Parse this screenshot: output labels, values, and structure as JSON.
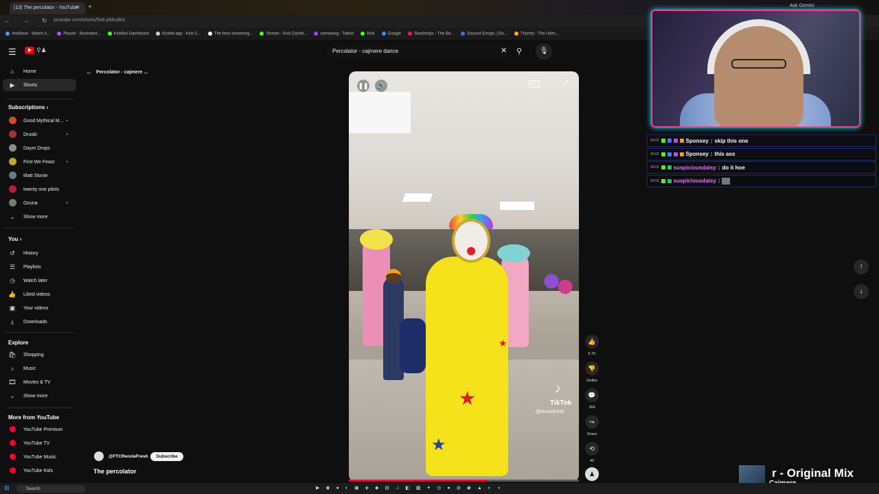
{
  "browser": {
    "tab_title": "(13) The percolator - YouTube",
    "new_tab": "+",
    "close": "✕",
    "ask_gemini": "Ask Gemini",
    "url": "youtube.com/shorts/5x6-p58udKs",
    "nav_icons": "← → ↻",
    "bookmarks": [
      {
        "label": "AniWave - Watch A...",
        "color": "#6b8cff"
      },
      {
        "label": "Placeit - Illustrated...",
        "color": "#9b5cff"
      },
      {
        "label": "KickBot Dashboard",
        "color": "#53fc18"
      },
      {
        "label": "Kicklet.app - Kick C...",
        "color": "#cccccc"
      },
      {
        "label": "The best streaming...",
        "color": "#ffffff"
      },
      {
        "label": "Stream - Kick Dashb...",
        "color": "#53fc18"
      },
      {
        "label": "samwiseg - Twitch",
        "color": "#9146ff"
      },
      {
        "label": "Kick",
        "color": "#53fc18"
      },
      {
        "label": "Google",
        "color": "#4285f4"
      },
      {
        "label": "Slackmojis - The Be...",
        "color": "#e01e5a"
      },
      {
        "label": "Discord Emojis | Dis...",
        "color": "#5865f2"
      },
      {
        "label": "Thomfy - The Ultim...",
        "color": "#f2b01e"
      }
    ]
  },
  "header": {
    "search_value": "Percolator - cajmere dance",
    "clear": "✕",
    "search_icon": "🔍",
    "mic_icon": "🎙"
  },
  "sidebar": {
    "main": [
      {
        "label": "Home",
        "icon": "⌂"
      },
      {
        "label": "Shorts",
        "icon": "▶"
      }
    ],
    "subscriptions_title": "Subscriptions ›",
    "subscriptions": [
      {
        "label": "Good Mythical M...",
        "color": "#d9472b",
        "live": "•"
      },
      {
        "label": "Druski",
        "color": "#a83232",
        "live": "•"
      },
      {
        "label": "Daym Drops",
        "color": "#8a8a8a",
        "live": ""
      },
      {
        "label": "First We Feast",
        "color": "#c7a32c",
        "live": "•"
      },
      {
        "label": "Matt Stonie",
        "color": "#6a7a8a",
        "live": ""
      },
      {
        "label": "twenty one pilots",
        "color": "#b5202a",
        "live": ""
      },
      {
        "label": "Ozuna",
        "color": "#7a7a7a",
        "live": "•"
      }
    ],
    "show_more": "Show more",
    "you_title": "You ›",
    "you": [
      {
        "label": "History",
        "icon": "↺"
      },
      {
        "label": "Playlists",
        "icon": "☰"
      },
      {
        "label": "Watch later",
        "icon": "◷"
      },
      {
        "label": "Liked videos",
        "icon": "👍"
      },
      {
        "label": "Your videos",
        "icon": "▣"
      },
      {
        "label": "Downloads",
        "icon": "⤓"
      }
    ],
    "explore_title": "Explore",
    "explore": [
      {
        "label": "Shopping",
        "icon": "🛍"
      },
      {
        "label": "Music",
        "icon": "♪"
      },
      {
        "label": "Movies & TV",
        "icon": "🎞"
      }
    ],
    "show_more_2": "Show more",
    "more_title": "More from YouTube",
    "more": [
      {
        "label": "YouTube Premium",
        "color": "#ff0033"
      },
      {
        "label": "YouTube TV",
        "color": "#ff0033"
      },
      {
        "label": "YouTube Music",
        "color": "#ff0033"
      },
      {
        "label": "YouTube Kids",
        "color": "#ff0033"
      }
    ]
  },
  "short": {
    "back_title": "Percolator - cajmere ...",
    "channel": "@FTCRenzieFresh",
    "subscribe": "Subscribe",
    "title": "The percolator",
    "tiktok": "TikTok",
    "tiktok_user": "@renziefresh",
    "cc": "CC",
    "progress": 0.6
  },
  "actions": {
    "like_count": "6.7K",
    "dislike": "Dislike",
    "comments": "364",
    "share": "Share",
    "remix": "40"
  },
  "chat": [
    {
      "time": "00:03",
      "user": "Sponsey",
      "user_color": "#ffffff",
      "msg": "skip this one",
      "badges": [
        "#53fc18",
        "#3b82f6",
        "#a855f7",
        "#f59e0b"
      ]
    },
    {
      "time": "00:03",
      "user": "Sponsey",
      "user_color": "#ffffff",
      "msg": "this ass",
      "badges": [
        "#53fc18",
        "#3b82f6",
        "#a855f7",
        "#f59e0b"
      ]
    },
    {
      "time": "00:03",
      "user": "suspiciousdaisy",
      "user_color": "#e879f9",
      "msg": "do it hoe",
      "badges": [
        "#53fc18",
        "#22c55e"
      ]
    },
    {
      "time": "00:03",
      "user": "suspiciousdaisy",
      "user_color": "#e879f9",
      "msg": "",
      "badges": [
        "#53fc18",
        "#22c55e"
      ]
    }
  ],
  "now_playing": {
    "title": "r - Original Mix",
    "artist": "Cajmere"
  },
  "taskbar": {
    "search": "Search"
  }
}
